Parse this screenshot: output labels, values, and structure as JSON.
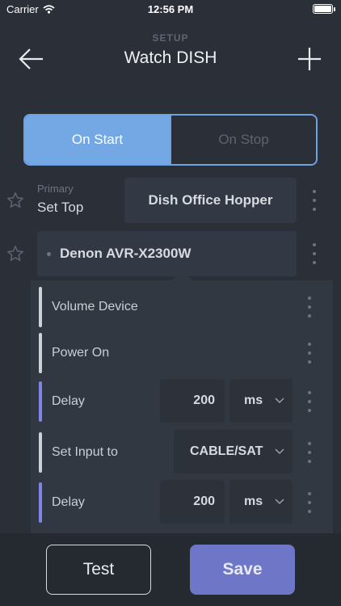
{
  "status_bar": {
    "carrier": "Carrier",
    "time": "12:56 PM"
  },
  "nav": {
    "kicker": "SETUP",
    "title": "Watch DISH",
    "back_icon": "arrow-left-icon",
    "add_icon": "plus-icon"
  },
  "segments": [
    {
      "label": "On Start",
      "selected": true
    },
    {
      "label": "On Stop",
      "selected": false
    }
  ],
  "devices": [
    {
      "role_label": "Primary",
      "type_label": "Set Top",
      "name": "Dish Office Hopper"
    },
    {
      "name": "Denon AVR-X2300W"
    }
  ],
  "steps": [
    {
      "label": "Volume Device",
      "bar": "white"
    },
    {
      "label": "Power On",
      "bar": "white"
    },
    {
      "label": "Delay",
      "bar": "purple",
      "value": "200",
      "unit": "ms"
    },
    {
      "label": "Set Input to",
      "bar": "white",
      "input": "CABLE/SAT"
    },
    {
      "label": "Delay",
      "bar": "purple",
      "value": "200",
      "unit": "ms"
    }
  ],
  "footer": {
    "test_label": "Test",
    "save_label": "Save"
  },
  "colors": {
    "background": "#2b3038",
    "accent_blue": "#74a8e4",
    "save_purple": "#6e76c8",
    "delay_bar": "#7f86e6"
  }
}
